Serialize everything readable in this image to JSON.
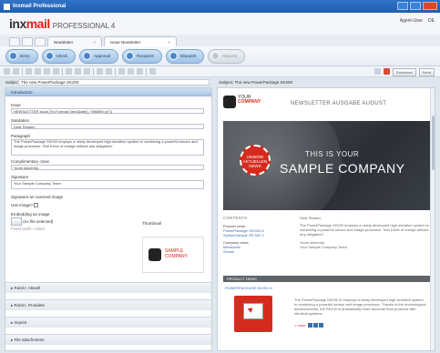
{
  "window": {
    "title": "Inxmail Professional"
  },
  "app": {
    "logo_main": "inx",
    "logo_accent": "mail",
    "logo_sub": "PROFESSIONAL 4"
  },
  "user": {
    "name": "Agent-User",
    "lang": "DE"
  },
  "tabs": [
    {
      "label": "Newsletter"
    },
    {
      "label": "Issue Newsletter"
    }
  ],
  "workflow": [
    {
      "label": "Entry"
    },
    {
      "label": "Check"
    },
    {
      "label": "Approval"
    },
    {
      "label": "Recipient"
    },
    {
      "label": "Dispatch"
    },
    {
      "label": "Reports"
    }
  ],
  "toolbar": {
    "btn1": "Download",
    "btn2": "Send"
  },
  "subject": {
    "label": "Subject:",
    "value": "The new PowerPackage SK200",
    "preview_label": "Subject:",
    "preview_value": "The new PowerPackage SK200"
  },
  "editor": {
    "section_intro": "Introduction",
    "issue_label": "Issue",
    "issue_value": "NEWSLETTER Issue [%=Format( SendDate(), \"MMMM yy\")]",
    "salutation_label": "Salutation",
    "salutation_value": "Dear Reader,",
    "paragraph_label": "Paragraph",
    "paragraph_value": "The PowerPackage SK200 employs a newly developed high sensitive system to combining a powerful sensor and image processor. Test it free of charge without any obligation!",
    "complimentary_label": "Complimentary close",
    "complimentary_value": "Yours sincerely,",
    "signature_label": "Signature",
    "signature_value": "Your Sample Company Team",
    "sig_image_label": "Signature as scanned image",
    "use_image_label": "Use image?",
    "embed_label": "Embedding an image",
    "file_value": "(no file selected)",
    "width_label": "Fixed width / inline",
    "thumbnail_label": "Thumbnail",
    "sections": [
      "Rubric: Aktuell",
      "Rubric: Produkte",
      "Imprint",
      "File attachments"
    ]
  },
  "preview": {
    "your_company_1": "YOUR",
    "your_company_2": "COMPANY",
    "newsletter_title": "NEWSLETTER AUSGABE AUGUST",
    "hero_line1": "THIS IS YOUR",
    "hero_line2": "SAMPLE COMPANY",
    "badge": "UNSERE AKTUELLEN NEWS",
    "contents": "CONTENTS",
    "product_news": "Product news",
    "product_items": [
      "PowerPackage SK200-III",
      "SystemSample SP-500 2"
    ],
    "company_news": "Company news",
    "company_items": [
      "Milestones",
      "Shows"
    ],
    "dear": "Dear Reader,",
    "body": "The PowerPackage SK200 employs a newly developed high sensitive system to combining a powerful sensor and image processor. Test it free of charge without any obligation!",
    "yours": "Yours sincerely",
    "team": "Your Sample Company Team",
    "product_bar": "PRODUCT NEWS",
    "product_title": "POWERPACKAGE SK200 III",
    "product_body": "The PowerPackage SK200 III employs a newly developed high sensitive system to combining a powerful sensor and image processor. Thanks to the technological advancements, the SK200 is dramatically more accurate than products with identical systems.",
    "more": "> more"
  },
  "thumb": {
    "line1": "SAMPLE",
    "line2": "COMPANY"
  }
}
